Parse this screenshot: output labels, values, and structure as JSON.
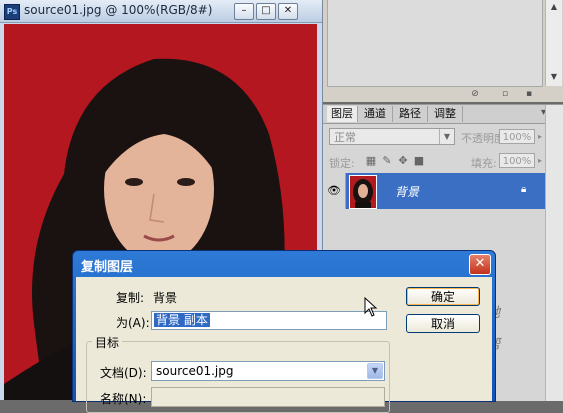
{
  "document": {
    "title": "source01.jpg @ 100%(RGB/8#)",
    "app_icon": "Ps",
    "window_buttons": [
      "–",
      "□",
      "✕"
    ]
  },
  "layers_panel": {
    "tabs": [
      "图层",
      "通道",
      "路径",
      "调整"
    ],
    "blend_mode": "正常",
    "opacity_label": "不透明度:",
    "opacity_value": "100%",
    "lock_label": "锁定:",
    "fill_label": "填充:",
    "fill_value": "100%",
    "layer_name": "背景",
    "colors": {
      "selected_row": "#3a6fc4"
    }
  },
  "dialog": {
    "title": "复制图层",
    "copy_label": "复制:",
    "copy_value": "背景",
    "as_label": "为(A):",
    "as_value": "背景 副本",
    "ok": "确定",
    "cancel": "取消",
    "target_group": "目标",
    "doc_label": "文档(D):",
    "doc_value": "source01.jpg",
    "name_label": "名称(N):"
  },
  "watermark": [
    "他她",
    "我帮",
    "你"
  ],
  "icons": [
    "ps-logo-icon",
    "eye-icon",
    "lock-icon",
    "close-icon",
    "dropdown-arrow-icon",
    "arrow-cursor-icon"
  ]
}
